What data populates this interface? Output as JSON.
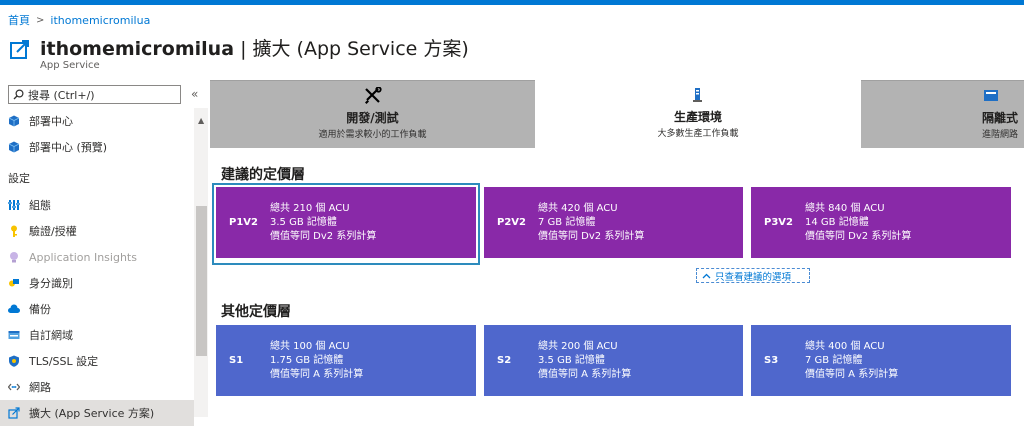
{
  "breadcrumb": {
    "home": "首頁",
    "resource": "ithomemicromilua"
  },
  "header": {
    "resource_name": "ithomemicromilua",
    "separator": " | ",
    "page": "擴大 (App Service 方案)",
    "subtitle": "App Service"
  },
  "search": {
    "placeholder": "搜尋 (Ctrl+/)",
    "collapse": "«"
  },
  "nav": {
    "deployment_center": "部署中心",
    "deployment_center_preview": "部署中心 (預覽)",
    "settings_header": "設定",
    "configuration": "組態",
    "auth": "驗證/授權",
    "app_insights": "Application Insights",
    "identity": "身分識別",
    "backups": "備份",
    "custom_domains": "自訂網域",
    "tls": "TLS/SSL 設定",
    "networking": "網路",
    "scale_up": "擴大 (App Service 方案)"
  },
  "tabs": [
    {
      "title": "開發/測試",
      "desc": "適用於需求較小的工作負載",
      "icon": "tools-icon"
    },
    {
      "title": "生產環境",
      "desc": "大多數生產工作負載",
      "icon": "production-icon"
    },
    {
      "title": "隔離式",
      "desc": "進階網路",
      "icon": "isolated-icon"
    }
  ],
  "recommended": {
    "title": "建議的定價層",
    "tiers": [
      {
        "name": "P1V2",
        "acu": "總共 210 個 ACU",
        "memory": "3.5 GB 記憶體",
        "compute": "價值等同 Dv2 系列計算"
      },
      {
        "name": "P2V2",
        "acu": "總共 420 個 ACU",
        "memory": "7 GB 記憶體",
        "compute": "價值等同 Dv2 系列計算"
      },
      {
        "name": "P3V2",
        "acu": "總共 840 個 ACU",
        "memory": "14 GB 記憶體",
        "compute": "價值等同 Dv2 系列計算"
      }
    ],
    "show_fewer": "只查看建議的選項"
  },
  "other": {
    "title": "其他定價層",
    "tiers": [
      {
        "name": "S1",
        "acu": "總共 100 個 ACU",
        "memory": "1.75 GB 記憶體",
        "compute": "價值等同 A 系列計算"
      },
      {
        "name": "S2",
        "acu": "總共 200 個 ACU",
        "memory": "3.5 GB 記憶體",
        "compute": "價值等同 A 系列計算"
      },
      {
        "name": "S3",
        "acu": "總共 400 個 ACU",
        "memory": "7 GB 記憶體",
        "compute": "價值等同 A 系列計算"
      }
    ]
  },
  "colors": {
    "accent": "#0078d4",
    "premium": "#8929a8",
    "standard": "#4f67cc",
    "selected_border": "#2d8bbd"
  }
}
